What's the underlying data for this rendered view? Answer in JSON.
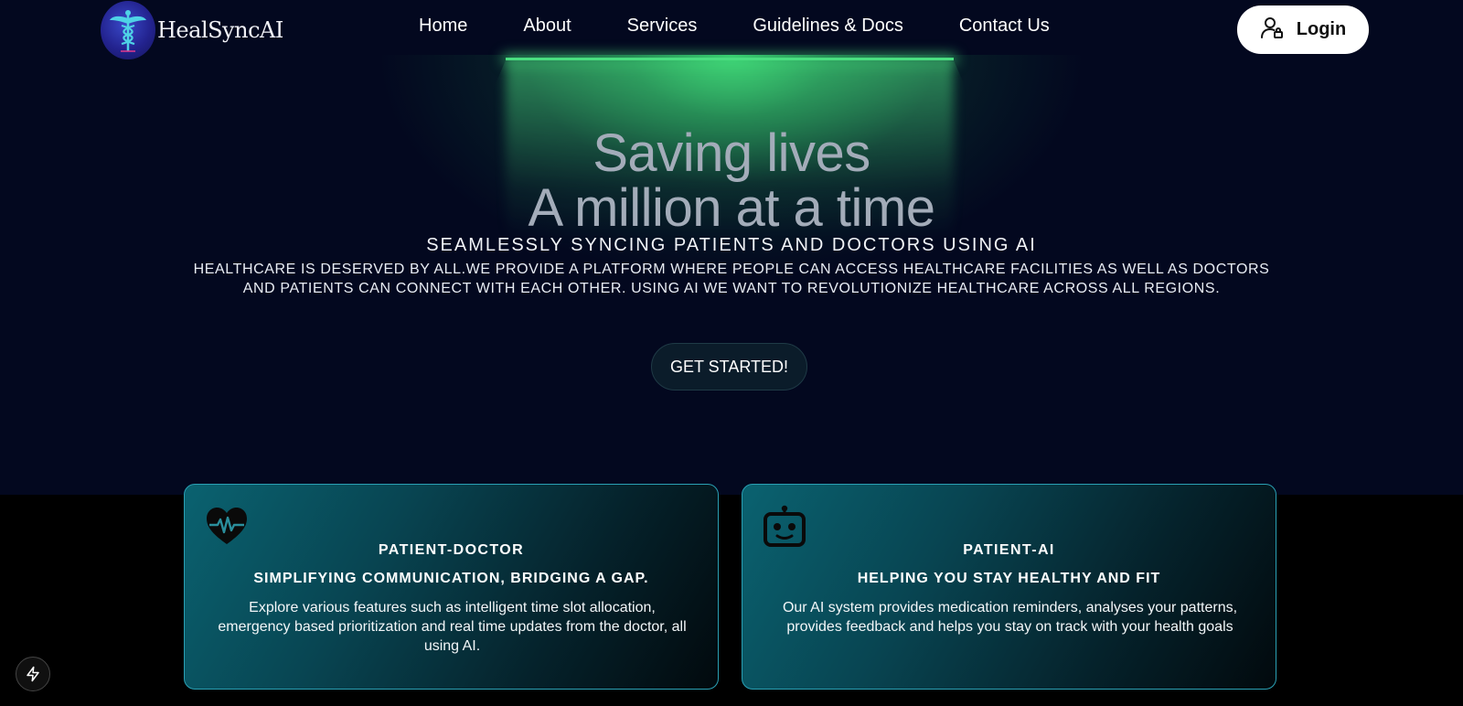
{
  "brand": {
    "name": "HealSyncAI",
    "logo_icon": "caduceus-icon"
  },
  "nav": {
    "items": [
      {
        "label": "Home"
      },
      {
        "label": "About"
      },
      {
        "label": "Services"
      },
      {
        "label": "Guidelines & Docs"
      },
      {
        "label": "Contact Us"
      }
    ]
  },
  "login": {
    "label": "Login",
    "icon": "user-lock-icon"
  },
  "hero": {
    "headline_line1": "Saving lives",
    "headline_line2": "A million at a time",
    "tagline": "SEAMLESSLY SYNCING PATIENTS AND DOCTORS USING AI",
    "description": "HEALTHCARE IS DESERVED BY ALL.WE PROVIDE A PLATFORM WHERE PEOPLE CAN ACCESS HEALTHCARE FACILITIES AS WELL AS DOCTORS AND PATIENTS CAN CONNECT WITH EACH OTHER. USING AI WE WANT TO REVOLUTIONIZE HEALTHCARE ACROSS ALL REGIONS.",
    "cta_label": "GET STARTED!"
  },
  "cards": [
    {
      "icon": "heartbeat-icon",
      "title": "PATIENT-DOCTOR",
      "subtitle": "SIMPLIFYING COMMUNICATION, BRIDGING A GAP.",
      "body": "Explore various features such as intelligent time slot allocation, emergency based prioritization and real time updates from the doctor, all using AI."
    },
    {
      "icon": "robot-icon",
      "title": "PATIENT-AI",
      "subtitle": "HELPING YOU STAY HEALTHY AND FIT",
      "body": "Our AI system provides medication reminders, analyses your patterns, provides feedback and helps you stay on track with your health goals"
    }
  ],
  "colors": {
    "hero_bg": "#03081f",
    "accent_green": "#4ade80",
    "card_border": "#2aa0b4",
    "headline": "#a3acb9"
  },
  "floating_button": {
    "icon": "lightning-bolt-icon"
  }
}
